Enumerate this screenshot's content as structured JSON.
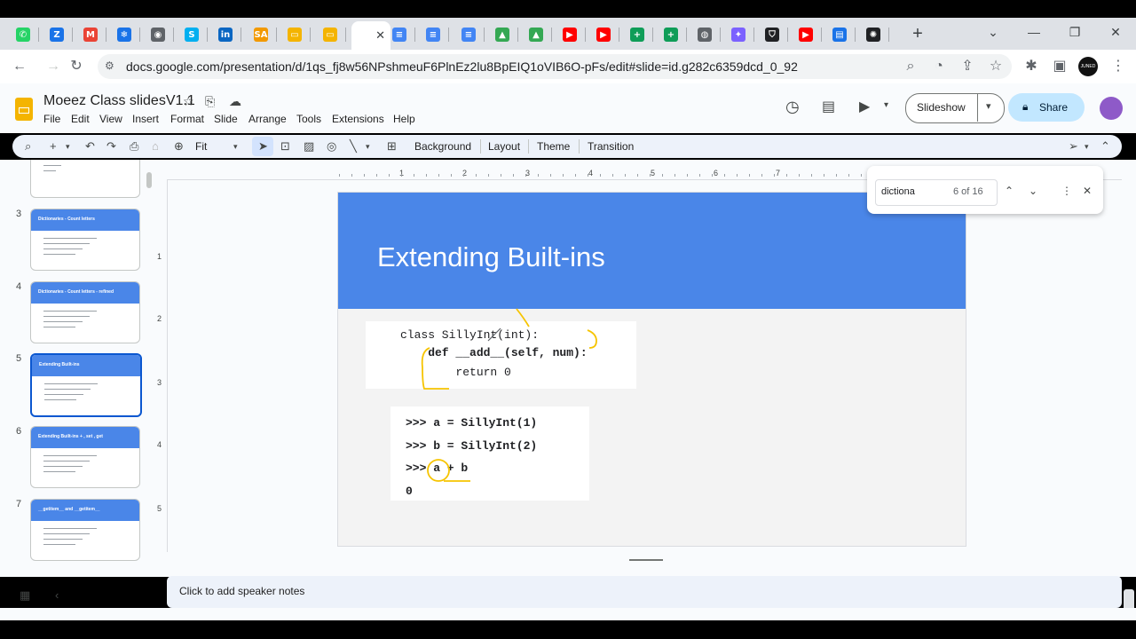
{
  "browser": {
    "tabs": [
      {
        "icon": "whatsapp-icon",
        "color": "#25d366",
        "glyph": "✆"
      },
      {
        "icon": "zoho-icon",
        "color": "#1a73e8",
        "glyph": "Z"
      },
      {
        "icon": "gmail-icon",
        "color": "#ea4335",
        "glyph": "M"
      },
      {
        "icon": "snowflake-icon",
        "color": "#1a73e8",
        "glyph": "❄"
      },
      {
        "icon": "profile-tab-icon",
        "color": "#5f6368",
        "glyph": "◉"
      },
      {
        "icon": "skype-icon",
        "color": "#00aff0",
        "glyph": "S"
      },
      {
        "icon": "linkedin-icon",
        "color": "#0a66c2",
        "glyph": "in"
      },
      {
        "icon": "sa-icon",
        "color": "#f29900",
        "glyph": "SA"
      },
      {
        "icon": "slides-tab-icon",
        "color": "#f4b400",
        "glyph": "▭"
      },
      {
        "icon": "slides-tab-icon-2",
        "color": "#f4b400",
        "glyph": "▭"
      },
      {
        "icon": "docs-tab-icon",
        "color": "#4285f4",
        "glyph": "≡"
      },
      {
        "icon": "docs-tab-icon-2",
        "color": "#4285f4",
        "glyph": "≡"
      },
      {
        "icon": "docs-tab-icon-3",
        "color": "#4285f4",
        "glyph": "≡"
      },
      {
        "icon": "drive-icon",
        "color": "#34a853",
        "glyph": "▲"
      },
      {
        "icon": "drive-icon-2",
        "color": "#34a853",
        "glyph": "▲"
      },
      {
        "icon": "youtube-icon",
        "color": "#ff0000",
        "glyph": "▶"
      },
      {
        "icon": "youtube-icon-2",
        "color": "#ff0000",
        "glyph": "▶"
      },
      {
        "icon": "sheets-icon",
        "color": "#0f9d58",
        "glyph": "+"
      },
      {
        "icon": "sheets-icon-2",
        "color": "#0f9d58",
        "glyph": "+"
      },
      {
        "icon": "globe-icon",
        "color": "#5f6368",
        "glyph": "◍"
      },
      {
        "icon": "gemini-icon",
        "color": "#7b61ff",
        "glyph": "✦"
      },
      {
        "icon": "shield-icon",
        "color": "#202124",
        "glyph": "⛉"
      },
      {
        "icon": "youtube-icon-3",
        "color": "#ff0000",
        "glyph": "▶"
      },
      {
        "icon": "docs-tab-icon-4",
        "color": "#1a73e8",
        "glyph": "▤"
      },
      {
        "icon": "openai-icon",
        "color": "#202124",
        "glyph": "✺"
      }
    ],
    "url": "docs.google.com/presentation/d/1qs_fj8w56NPshmeuF6PlnEz2lu8BpEIQ1oVIB6O-pFs/edit#slide=id.g282c6359dcd_0_92",
    "new_tab": "+",
    "profile_label": "JUNED"
  },
  "app": {
    "title": "Moeez Class slidesV1.1",
    "menus": [
      "File",
      "Edit",
      "View",
      "Insert",
      "Format",
      "Slide",
      "Arrange",
      "Tools",
      "Extensions",
      "Help"
    ],
    "slideshow_label": "Slideshow",
    "share_label": "Share",
    "zoom_label": "Fit",
    "toolbar_text": [
      "Background",
      "Layout",
      "Theme",
      "Transition"
    ]
  },
  "find": {
    "query": "dictiona",
    "count": "6 of 16"
  },
  "thumbnails": [
    {
      "num": "3",
      "title": "Dictionaries - Count letters"
    },
    {
      "num": "4",
      "title": "Dictionaries - Count letters - refined"
    },
    {
      "num": "5",
      "title": "Extending Built-ins"
    },
    {
      "num": "6",
      "title": "Extending Built-ins + , set , get"
    },
    {
      "num": "7",
      "title": "__getitem__ and __getitem__"
    }
  ],
  "rulers": {
    "top": [
      "1",
      "2",
      "3",
      "4",
      "5",
      "6",
      "7"
    ],
    "left": [
      "1",
      "2",
      "3",
      "4",
      "5"
    ]
  },
  "slide": {
    "title": "Extending Built-ins",
    "code1": [
      "class SillyInt(int):",
      "    def __add__(self, num):",
      "        return 0"
    ],
    "code2": [
      ">>> a = SillyInt(1)",
      ">>> b = SillyInt(2)",
      ">>> a + b",
      "0"
    ]
  },
  "notes": {
    "placeholder": "Click to add speaker notes"
  },
  "colors": {
    "slide_header": "#4a86e8",
    "annotation": "#f6c400",
    "share_button": "#c2e7ff"
  }
}
